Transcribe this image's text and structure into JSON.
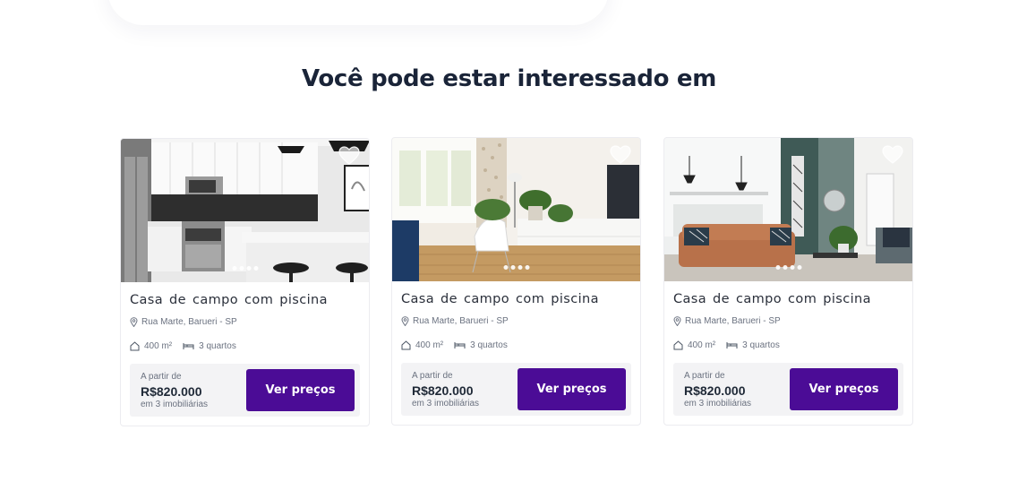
{
  "section": {
    "title": "Você pode estar interessado em"
  },
  "cards": [
    {
      "title": "Casa de campo com piscina",
      "address": "Rua Marte, Barueri - SP",
      "area": "400 m²",
      "rooms": "3 quartos",
      "price_from": "A partir de",
      "price": "R$820.000",
      "agencies": "em 3 imobiliárias",
      "cta": "Ver preços",
      "photo_icon": "kitchen-photo"
    },
    {
      "title": "Casa de campo com piscina",
      "address": "Rua Marte, Barueri - SP",
      "area": "400 m²",
      "rooms": "3 quartos",
      "price_from": "A partir de",
      "price": "R$820.000",
      "agencies": "em 3 imobiliárias",
      "cta": "Ver preços",
      "photo_icon": "living-room-photo"
    },
    {
      "title": "Casa de campo com piscina",
      "address": "Rua Marte, Barueri - SP",
      "area": "400 m²",
      "rooms": "3 quartos",
      "price_from": "A partir de",
      "price": "R$820.000",
      "agencies": "em 3 imobiliárias",
      "cta": "Ver preços",
      "photo_icon": "lounge-photo"
    }
  ],
  "colors": {
    "accent": "#4b0c96",
    "title": "#1a2438",
    "muted": "#6b7280",
    "price_box": "#f3f3f5"
  }
}
